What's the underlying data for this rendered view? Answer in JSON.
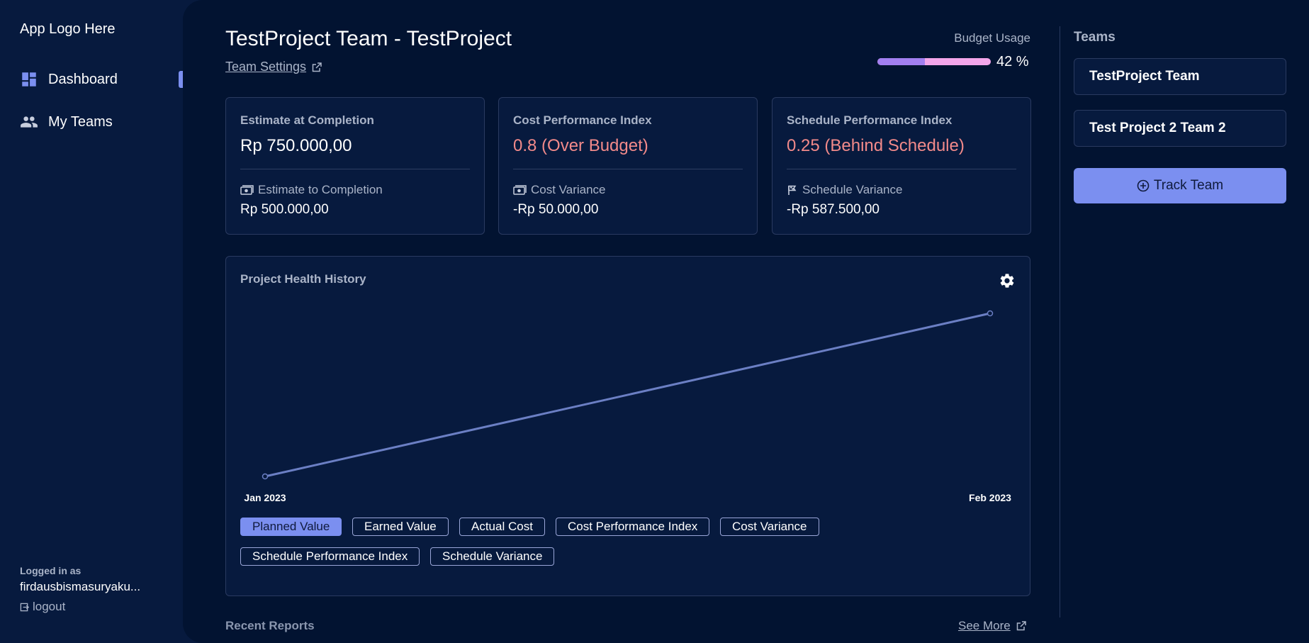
{
  "sidebar": {
    "logo": "App Logo Here",
    "items": [
      {
        "label": "Dashboard",
        "icon": "dashboard-icon",
        "active": true
      },
      {
        "label": "My Teams",
        "icon": "people-icon",
        "active": false
      }
    ],
    "logged_in_label": "Logged in as",
    "username": "firdausbismasuryaku...",
    "logout_label": "logout"
  },
  "header": {
    "title": "TestProject Team - TestProject",
    "team_settings": "Team Settings",
    "budget_label": "Budget Usage",
    "budget_value": "42 %",
    "budget_fraction": 0.42
  },
  "cards": [
    {
      "title": "Estimate at Completion",
      "value": "Rp 750.000,00",
      "sub_label": "Estimate to Completion",
      "sub_icon": "money-icon",
      "sub_value": "Rp 500.000,00"
    },
    {
      "title": "Cost Performance Index",
      "value": "0.8 (Over Budget)",
      "sub_label": "Cost Variance",
      "sub_icon": "money-icon",
      "sub_value": "-Rp 50.000,00"
    },
    {
      "title": "Schedule Performance Index",
      "value": "0.25 (Behind Schedule)",
      "sub_label": "Schedule Variance",
      "sub_icon": "flag-icon",
      "sub_value": "-Rp 587.500,00"
    }
  ],
  "chart_panel": {
    "title": "Project Health History",
    "chips": [
      {
        "label": "Planned Value",
        "active": true
      },
      {
        "label": "Earned Value",
        "active": false
      },
      {
        "label": "Actual Cost",
        "active": false
      },
      {
        "label": "Cost Performance Index",
        "active": false
      },
      {
        "label": "Cost Variance",
        "active": false
      },
      {
        "label": "Schedule Performance Index",
        "active": false
      },
      {
        "label": "Schedule Variance",
        "active": false
      }
    ]
  },
  "chart_data": {
    "type": "line",
    "x": [
      "Jan 2023",
      "Feb 2023"
    ],
    "series": [
      {
        "values": [
          0,
          1
        ]
      }
    ],
    "grid": false,
    "line_color": "#6b7fc4"
  },
  "recent": {
    "title": "Recent Reports",
    "see_more": "See More"
  },
  "teams_panel": {
    "heading": "Teams",
    "teams": [
      "TestProject Team",
      "Test Project 2 Team 2"
    ],
    "track_button": "Track Team"
  },
  "colors": {
    "accent": "#7b8ff0",
    "danger": "#f28a8a",
    "budget_fill": "#a27ff0",
    "budget_track": "#f3a6ea"
  }
}
